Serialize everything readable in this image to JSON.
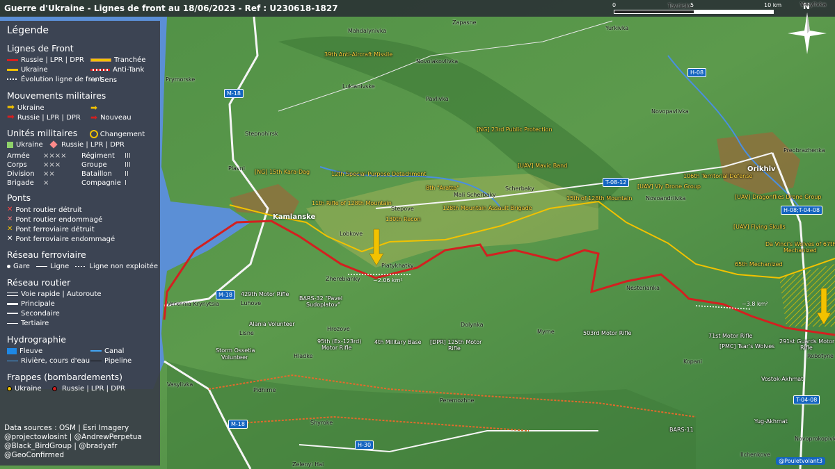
{
  "title": "Guerre d'Ukraine - Lignes de front au 18/06/2023 - Ref : U230618-1827",
  "scale": {
    "t0": "0",
    "t1": "5",
    "t2": "10 km"
  },
  "compass": "N",
  "legend": {
    "title": "Légende",
    "front_title": "Lignes de Front",
    "russia_line": "Russie | LPR | DPR",
    "ukraine_line": "Ukraine",
    "evolution": "Évolution ligne de front",
    "trench": "Tranchée",
    "antitank": "Anti-Tank",
    "sens": "Sens",
    "moves_title": "Mouvements militaires",
    "move_ua": "Ukraine",
    "move_ru": "Russie | LPR | DPR",
    "nouveau": "Nouveau",
    "units_title": "Unités militaires",
    "changement": "Changement",
    "unit_ua": "Ukraine",
    "unit_ru": "Russie | LPR | DPR",
    "grid": [
      {
        "a": "Armée",
        "as": "××××",
        "b": "Régiment",
        "bs": "III"
      },
      {
        "a": "Corps",
        "as": "×××",
        "b": "Groupe",
        "bs": "III"
      },
      {
        "a": "Division",
        "as": "××",
        "b": "Bataillon",
        "bs": "II"
      },
      {
        "a": "Brigade",
        "as": "×",
        "b": "Compagnie",
        "bs": "I"
      }
    ],
    "bridges_title": "Ponts",
    "b1": "Pont routier détruit",
    "b2": "Pont routier endommagé",
    "b3": "Pont ferroviaire détruit",
    "b4": "Pont ferroviaire endommagé",
    "rail_title": "Réseau ferroviaire",
    "gare": "Gare",
    "ligne": "Ligne",
    "ligne_ne": "Ligne non exploitée",
    "road_title": "Réseau routier",
    "r1": "Voie rapide | Autoroute",
    "r2": "Principale",
    "r3": "Secondaire",
    "r4": "Tertiaire",
    "hydro_title": "Hydrographie",
    "fleuve": "Fleuve",
    "canal": "Canal",
    "riviere": "Rivière, cours d'eau",
    "pipeline": "Pipeline",
    "strikes_title": "Frappes (bombardements)",
    "s_ua": "Ukraine",
    "s_ru": "Russie | LPR | DPR",
    "sources": [
      "Data sources : OSM | Esri Imagery",
      "@projectowlosint | @AndrewPerpetua",
      "@Black_BirdGroup | @bradyafr",
      "@GeoConfirmed"
    ]
  },
  "colors": {
    "russia": "#d32020",
    "ukraine": "#f2c200",
    "water": "#5b8fd6",
    "terrain": "#4d8a3e"
  },
  "roads": [
    {
      "id": "m18a",
      "text": "M-18"
    },
    {
      "id": "m18b",
      "text": "M-18"
    },
    {
      "id": "m18c",
      "text": "M-18"
    },
    {
      "id": "h08",
      "text": "H-08"
    },
    {
      "id": "t0812",
      "text": "T-08-12"
    },
    {
      "id": "h08t",
      "text": "H-08;T-04-08"
    },
    {
      "id": "t0408",
      "text": "T-04-08"
    },
    {
      "id": "h30",
      "text": "H-30"
    }
  ],
  "towns": [
    {
      "id": "mahd",
      "text": "Mahdalynivka"
    },
    {
      "id": "zap",
      "text": "Zapasne"
    },
    {
      "id": "yurk",
      "text": "Yurkivka"
    },
    {
      "id": "prym",
      "text": "Prymorske"
    },
    {
      "id": "novoi",
      "text": "Novoiakovlivka"
    },
    {
      "id": "luk",
      "text": "Lukianivske"
    },
    {
      "id": "pav",
      "text": "Pavlivka"
    },
    {
      "id": "novop",
      "text": "Novopavlivka"
    },
    {
      "id": "step",
      "text": "Stepnohirsk"
    },
    {
      "id": "prej",
      "text": "Preobrazhenka"
    },
    {
      "id": "plav",
      "text": "Plavni"
    },
    {
      "id": "mali",
      "text": "Mali Scherbaky"
    },
    {
      "id": "scher",
      "text": "Scherbaky"
    },
    {
      "id": "novoan",
      "text": "Novoandriivka"
    },
    {
      "id": "stepove",
      "text": "Stepove"
    },
    {
      "id": "lob",
      "text": "Lobkove"
    },
    {
      "id": "plat",
      "text": "Piatykhatky"
    },
    {
      "id": "zhe",
      "text": "Zherebianky"
    },
    {
      "id": "nest",
      "text": "Nesterianka"
    },
    {
      "id": "verk",
      "text": "Verkhnia Krynytsia"
    },
    {
      "id": "luh",
      "text": "Luhove"
    },
    {
      "id": "lisne",
      "text": "Lisne"
    },
    {
      "id": "hroz",
      "text": "Hrozove"
    },
    {
      "id": "dol",
      "text": "Dolynka"
    },
    {
      "id": "myrne",
      "text": "Myrne"
    },
    {
      "id": "hlad",
      "text": "Hladke"
    },
    {
      "id": "kop",
      "text": "Kopani"
    },
    {
      "id": "rob",
      "text": "Robotyne"
    },
    {
      "id": "vas",
      "text": "Vasylivka"
    },
    {
      "id": "pid",
      "text": "Pidhirne"
    },
    {
      "id": "per",
      "text": "Peremozhne"
    },
    {
      "id": "shy",
      "text": "Shyroke"
    },
    {
      "id": "zel",
      "text": "Zelenyi Hai"
    },
    {
      "id": "npk",
      "text": "Novoprokopivka"
    },
    {
      "id": "ilch",
      "text": "Ilchenkove"
    },
    {
      "id": "tav",
      "text": "Tavriiske"
    },
    {
      "id": "vasy",
      "text": "Vasylivka"
    }
  ],
  "cities": [
    {
      "id": "kam",
      "text": "Kamianske"
    },
    {
      "id": "ori",
      "text": "Orikhiv"
    }
  ],
  "ua_units": [
    {
      "id": "u39",
      "text": "39th Anti-Aircraft Missile"
    },
    {
      "id": "ung23",
      "text": "[NG] 23rd Public Protection"
    },
    {
      "id": "umav",
      "text": "[UAV] Mavic Band"
    },
    {
      "id": "ung15",
      "text": "[NG] 15th Kara-Dag"
    },
    {
      "id": "u12",
      "text": "12th Special Purpose Detachment"
    },
    {
      "id": "u8",
      "text": "8th \"Aratta\""
    },
    {
      "id": "u106",
      "text": "106th Territorial Defense"
    },
    {
      "id": "uviy",
      "text": "[UAV] Viy Drone Group"
    },
    {
      "id": "u15",
      "text": "15th of 128th Mountain"
    },
    {
      "id": "udrag",
      "text": "[UAV] Dragonflies Drone Group"
    },
    {
      "id": "u11",
      "text": "11th Rifle of 128th Mountain"
    },
    {
      "id": "u128",
      "text": "128th Mountain Assault Brigade"
    },
    {
      "id": "u130",
      "text": "130th Recon"
    },
    {
      "id": "ufly",
      "text": "[UAV] Flying Skulls"
    },
    {
      "id": "udav",
      "text": "Da Vinci's Wolves of 67th"
    },
    {
      "id": "udav2",
      "text": "Mechanized"
    },
    {
      "id": "u65",
      "text": "65th Mechanized"
    }
  ],
  "ru_units": [
    {
      "id": "r429",
      "text": "429th Motor Rifle"
    },
    {
      "id": "rbars",
      "text": "BARS-32 \"Pavel"
    },
    {
      "id": "rbars2",
      "text": "Sudoplatov\""
    },
    {
      "id": "ral",
      "text": "Alania Volunteer"
    },
    {
      "id": "r95",
      "text": "95th (Ex-123rd)"
    },
    {
      "id": "r95b",
      "text": "Motor Rifle"
    },
    {
      "id": "r4",
      "text": "4th Military Base"
    },
    {
      "id": "r125",
      "text": "[DPR] 125th Motor"
    },
    {
      "id": "r125b",
      "text": "Rifle"
    },
    {
      "id": "r503",
      "text": "503rd Motor Rifle"
    },
    {
      "id": "r71",
      "text": "71st Motor Rifle"
    },
    {
      "id": "rtsar",
      "text": "[PMC] Tsar's Wolves"
    },
    {
      "id": "r291",
      "text": "291st Guards Motor"
    },
    {
      "id": "r291b",
      "text": "Rifle"
    },
    {
      "id": "rso",
      "text": "Storm Ossetia"
    },
    {
      "id": "rso2",
      "text": "Volunteer"
    },
    {
      "id": "rvost",
      "text": "Vostok-Akhmat"
    },
    {
      "id": "ryug",
      "text": "Yug-Akhmat"
    },
    {
      "id": "rb11",
      "text": "BARS-11"
    }
  ],
  "areas": [
    {
      "id": "a1",
      "text": "~2.06 km²"
    },
    {
      "id": "a2",
      "text": "~3.8 km²"
    }
  ],
  "credit": "@Pouletvolant3"
}
